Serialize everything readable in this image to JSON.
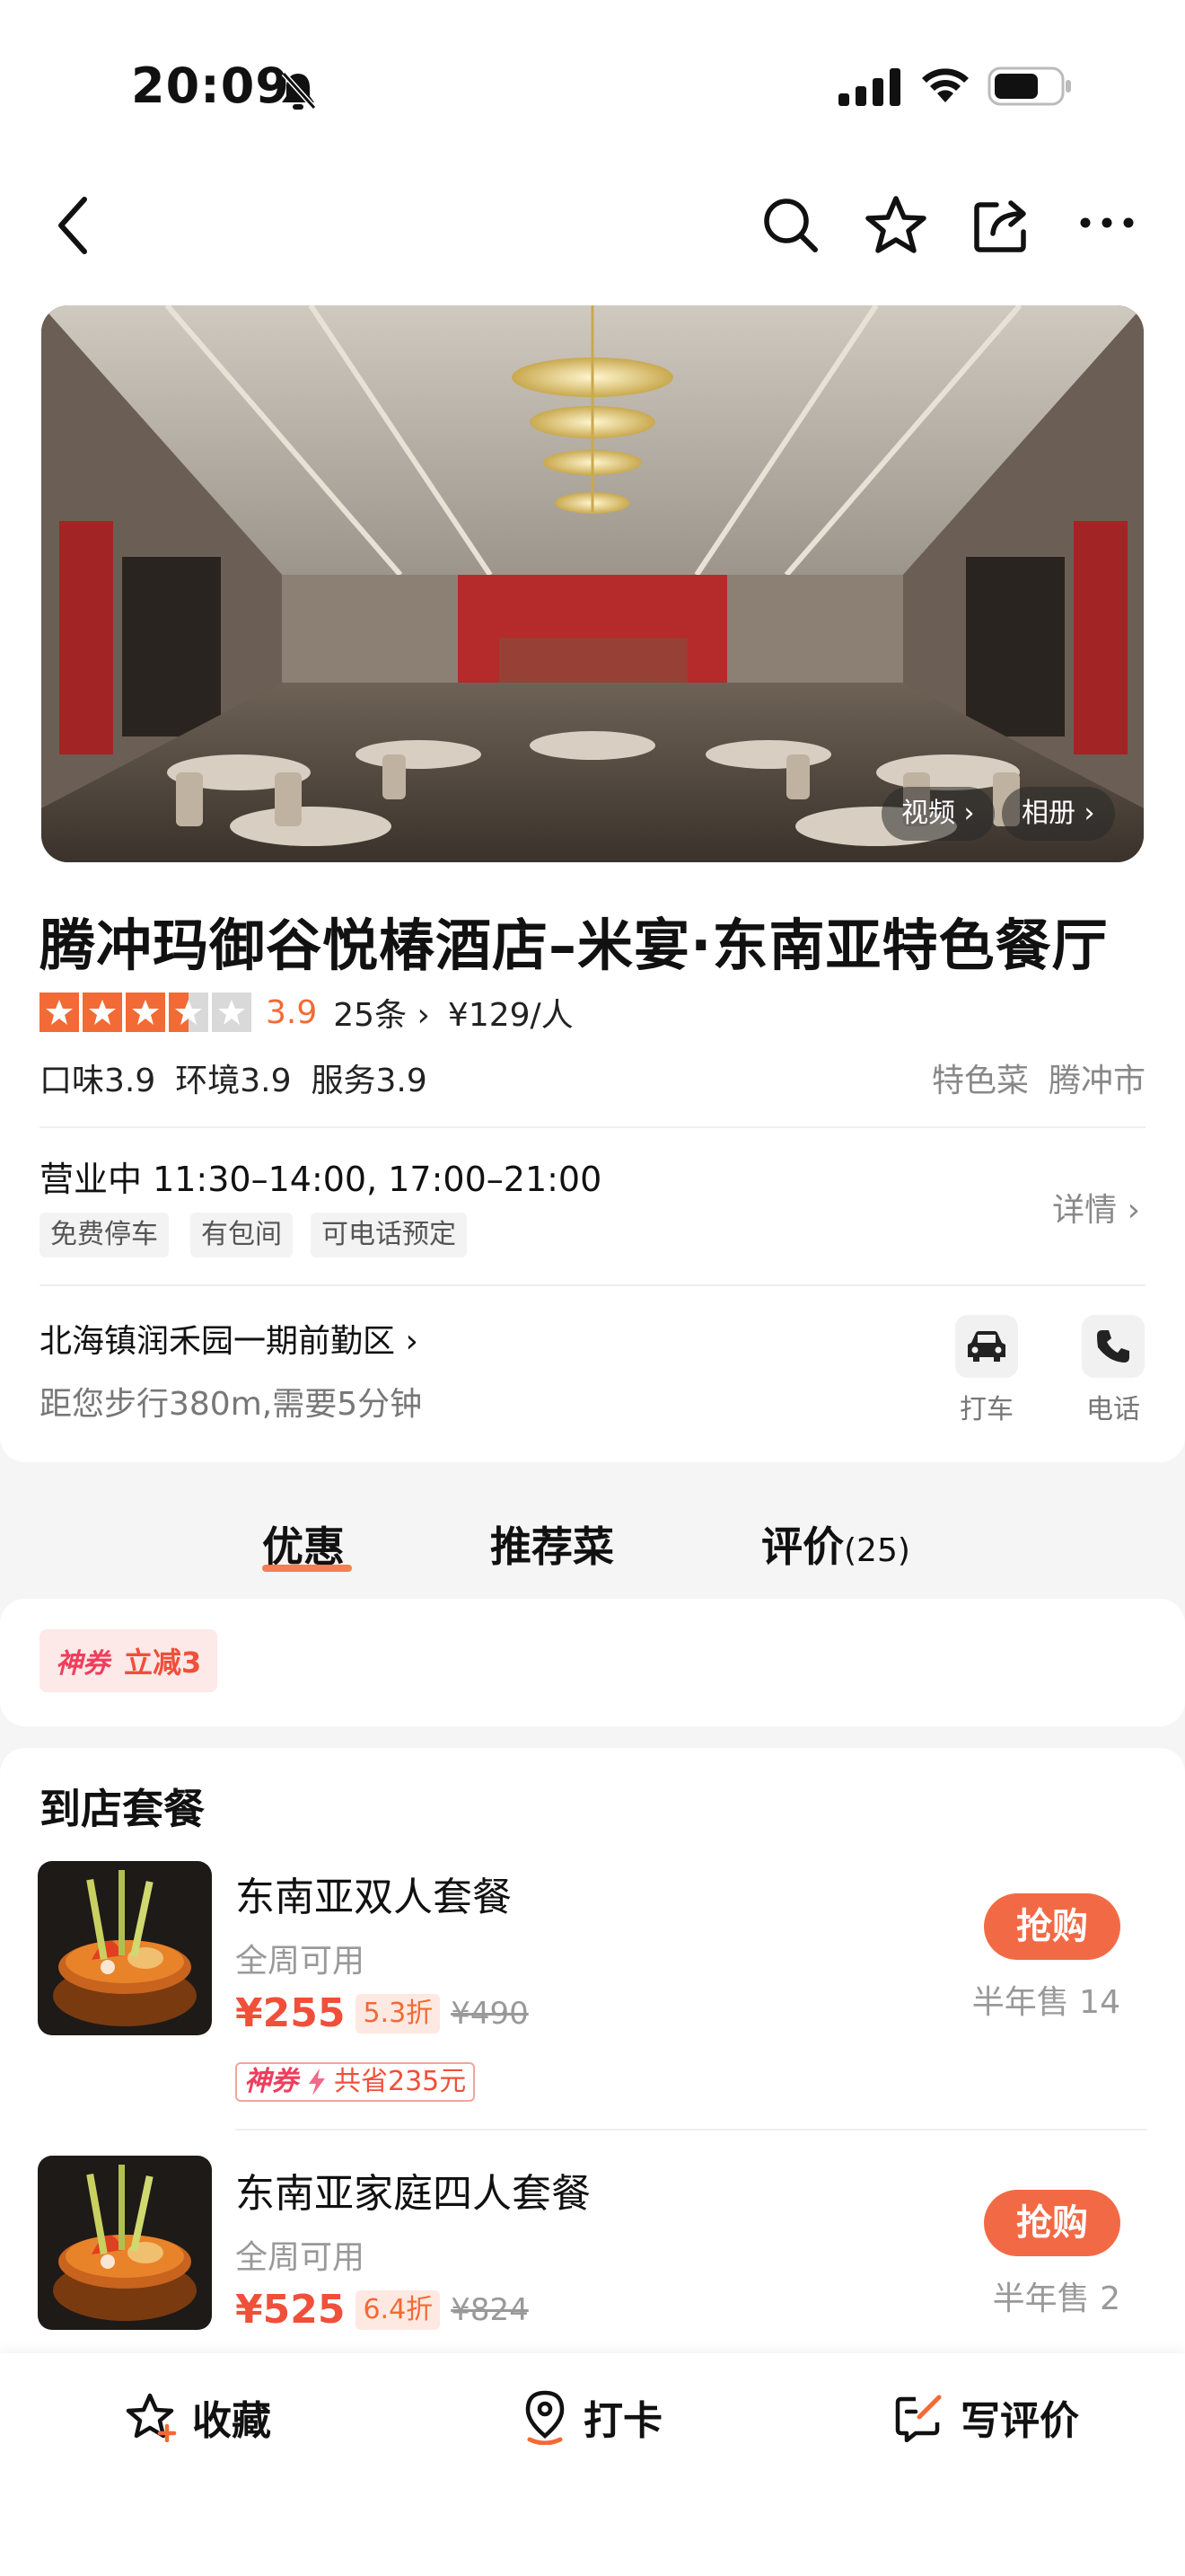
{
  "status_bar": {
    "time": "20:09"
  },
  "hero": {
    "video_label": "视频",
    "album_label": "相册"
  },
  "restaurant": {
    "name": "腾冲玛御谷悦椿酒店–米宴·东南亚特色餐厅",
    "rating": "3.9",
    "rating_value": 3.5,
    "reviews": "25条",
    "price_per_person": "¥129/人",
    "scores": [
      "口味3.9",
      "环境3.9",
      "服务3.9"
    ],
    "tags": [
      "特色菜",
      "腾冲市"
    ],
    "hours": "营业中  11:30–14:00, 17:00–21:00",
    "facilities": [
      "免费停车",
      "有包间",
      "可电话预定"
    ],
    "detail_label": "详情",
    "address": "北海镇润禾园一期前勤区",
    "distance": "距您步行380m,需要5分钟",
    "actions": {
      "taxi": "打车",
      "phone": "电话"
    }
  },
  "tabs": [
    {
      "label": "优惠",
      "count": ""
    },
    {
      "label": "推荐菜",
      "count": ""
    },
    {
      "label": "评价",
      "count": "(25)"
    }
  ],
  "coupon": {
    "brand": "神券",
    "text": "立减3"
  },
  "packages": {
    "section_title": "到店套餐",
    "items": [
      {
        "name": "东南亚双人套餐",
        "availability": "全周可用",
        "price": "¥255",
        "discount": "5.3折",
        "original_price": "¥490",
        "saving_brand": "神券",
        "saving": "共省235元",
        "button": "抢购",
        "sold": "半年售 14"
      },
      {
        "name": "东南亚家庭四人套餐",
        "availability": "全周可用",
        "price": "¥525",
        "discount": "6.4折",
        "original_price": "¥824",
        "button": "抢购",
        "sold": "半年售 2"
      }
    ]
  },
  "bottom_bar": {
    "favorite": "收藏",
    "checkin": "打卡",
    "review": "写评价"
  },
  "colors": {
    "accent": "#f26a35",
    "price_red": "#f04f3a",
    "coupon_pink": "#ef3e5c"
  }
}
